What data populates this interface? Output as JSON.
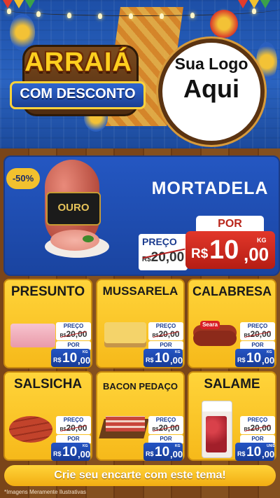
{
  "header": {
    "title_line1": "ARRAIÁ",
    "title_line2": "COM DESCONTO",
    "logo_line1": "Sua Logo",
    "logo_line2": "Aqui"
  },
  "featured": {
    "discount_badge": "-50%",
    "brand_label": "OURO",
    "product": "MORTADELA",
    "old_label": "PREÇO",
    "old_currency": "R$",
    "old_price": "20,00",
    "new_label": "POR",
    "new_currency": "R$",
    "new_price_int": "10",
    "new_price_dec": ",00",
    "unit": "KG"
  },
  "products": [
    {
      "name": "PRESUNTO",
      "old_label": "PREÇO",
      "old_currency": "R$",
      "old_price": "20,00",
      "new_label": "POR",
      "currency": "R$",
      "price_int": "10",
      "price_dec": ",00",
      "unit": "KG"
    },
    {
      "name": "MUSSARELA",
      "old_label": "PREÇO",
      "old_currency": "R$",
      "old_price": "20,00",
      "new_label": "POR",
      "currency": "R$",
      "price_int": "10",
      "price_dec": ",00",
      "unit": "KG"
    },
    {
      "name": "CALABRESA",
      "brand": "Seara",
      "old_label": "PREÇO",
      "old_currency": "R$",
      "old_price": "20,00",
      "new_label": "POR",
      "currency": "R$",
      "price_int": "10",
      "price_dec": ",00",
      "unit": "KG"
    },
    {
      "name": "SALSICHA",
      "old_label": "PREÇO",
      "old_currency": "R$",
      "old_price": "20,00",
      "new_label": "POR",
      "currency": "R$",
      "price_int": "10",
      "price_dec": ",00",
      "unit": "KG"
    },
    {
      "name": "BACON PEDAÇO",
      "old_label": "PREÇO",
      "old_currency": "R$",
      "old_price": "20,00",
      "new_label": "POR",
      "currency": "R$",
      "price_int": "10",
      "price_dec": ",00",
      "unit": "KG"
    },
    {
      "name": "SALAME",
      "old_label": "PREÇO",
      "old_currency": "R$",
      "old_price": "20,00",
      "new_label": "POR",
      "currency": "R$",
      "price_int": "10",
      "price_dec": ",00",
      "unit": "UNID"
    }
  ],
  "footer": {
    "cta": "Crie seu encarte com este tema!",
    "disclaimer": "*Imagens Meramente Ilustrativas"
  },
  "colors": {
    "header_blue": "#2a63c0",
    "accent_yellow": "#ffd43a",
    "price_red": "#e2372a",
    "price_blue": "#2454c4",
    "wood": "#7a4519"
  }
}
